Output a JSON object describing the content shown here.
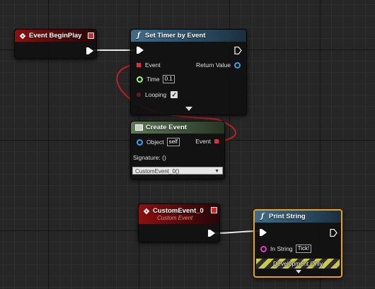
{
  "nodes": {
    "event_begin_play": {
      "title": "Event BeginPlay"
    },
    "set_timer": {
      "title": "Set Timer by Event",
      "event_label": "Event",
      "return_value_label": "Return Value",
      "time_label": "Time",
      "time_value": "0.1",
      "looping_label": "Looping",
      "looping_checked": "✓"
    },
    "create_event": {
      "title": "Create Event",
      "object_label": "Object",
      "object_value": "self",
      "event_label": "Event",
      "signature_label": "Signature: ()",
      "signature_value": "CustomEvent_0()"
    },
    "custom_event": {
      "title": "CustomEvent_0",
      "subtitle": "Custom Event"
    },
    "print_string": {
      "title": "Print String",
      "in_string_label": "In String",
      "in_string_value": "Tick!",
      "development_only": "Development Only"
    }
  },
  "colors": {
    "exec": "#ffffff",
    "delegate": "#e03030",
    "object": "#3fa0e6",
    "float": "#9eff5c",
    "string": "#e040c0",
    "selection": "#e8a020"
  },
  "icons": {
    "event": "diamond-icon",
    "function": "function-icon",
    "create_event": "grid-icon"
  }
}
